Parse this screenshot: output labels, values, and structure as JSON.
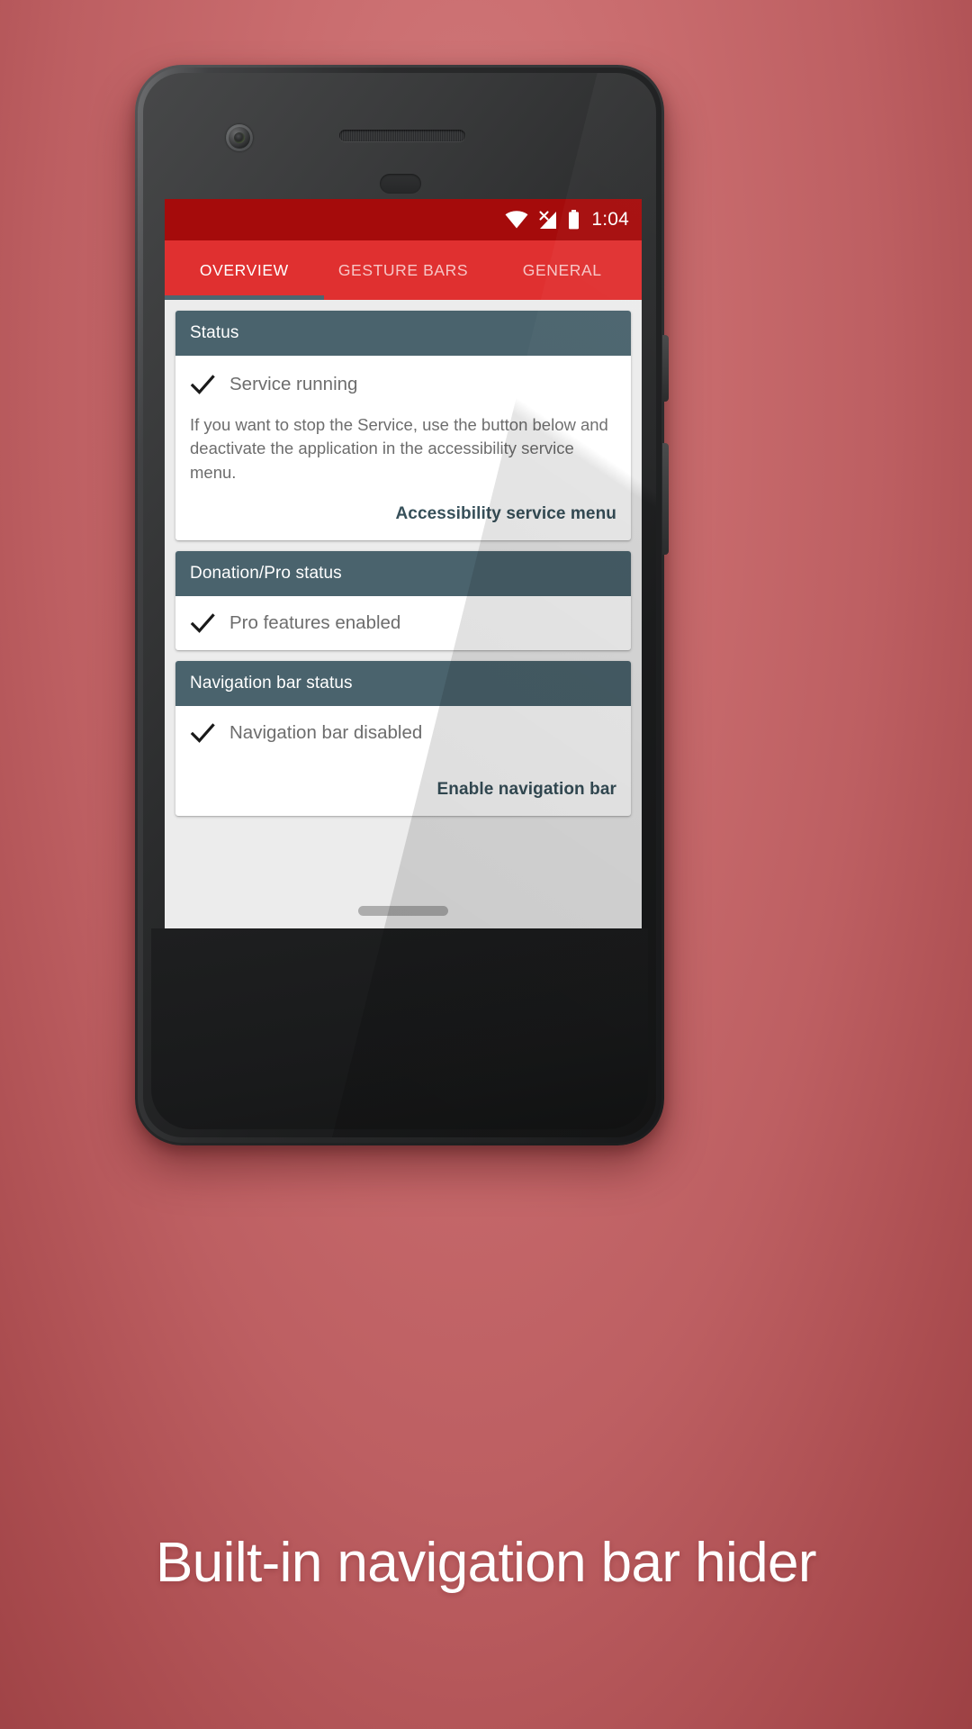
{
  "caption": "Built-in navigation bar hider",
  "theme": {
    "background_top": "#d27a7c",
    "background_bottom": "#9d4144",
    "statusbar_red": "#a50b0b",
    "tabbar_red": "#e03030",
    "card_header_slate": "#4a636d",
    "link_slate": "#37505a",
    "content_grey": "#ececec"
  },
  "statusbar": {
    "time": "1:04",
    "icons": [
      "wifi-icon",
      "cell-signal-off-icon",
      "battery-icon"
    ]
  },
  "tabs": [
    {
      "label": "OVERVIEW",
      "active": true
    },
    {
      "label": "GESTURE BARS",
      "active": false
    },
    {
      "label": "GENERAL",
      "active": false
    }
  ],
  "cards": [
    {
      "title": "Status",
      "status_text": "Service running",
      "status_icon": "check-icon",
      "description": "If you want to stop the Service, use the button below and deactivate the application in the accessibility service menu.",
      "action_label": "Accessibility service menu"
    },
    {
      "title": "Donation/Pro status",
      "status_text": "Pro features enabled",
      "status_icon": "check-icon",
      "description": "",
      "action_label": ""
    },
    {
      "title": "Navigation bar status",
      "status_text": "Navigation bar disabled",
      "status_icon": "check-icon",
      "description": "",
      "action_label": "Enable navigation bar"
    }
  ]
}
